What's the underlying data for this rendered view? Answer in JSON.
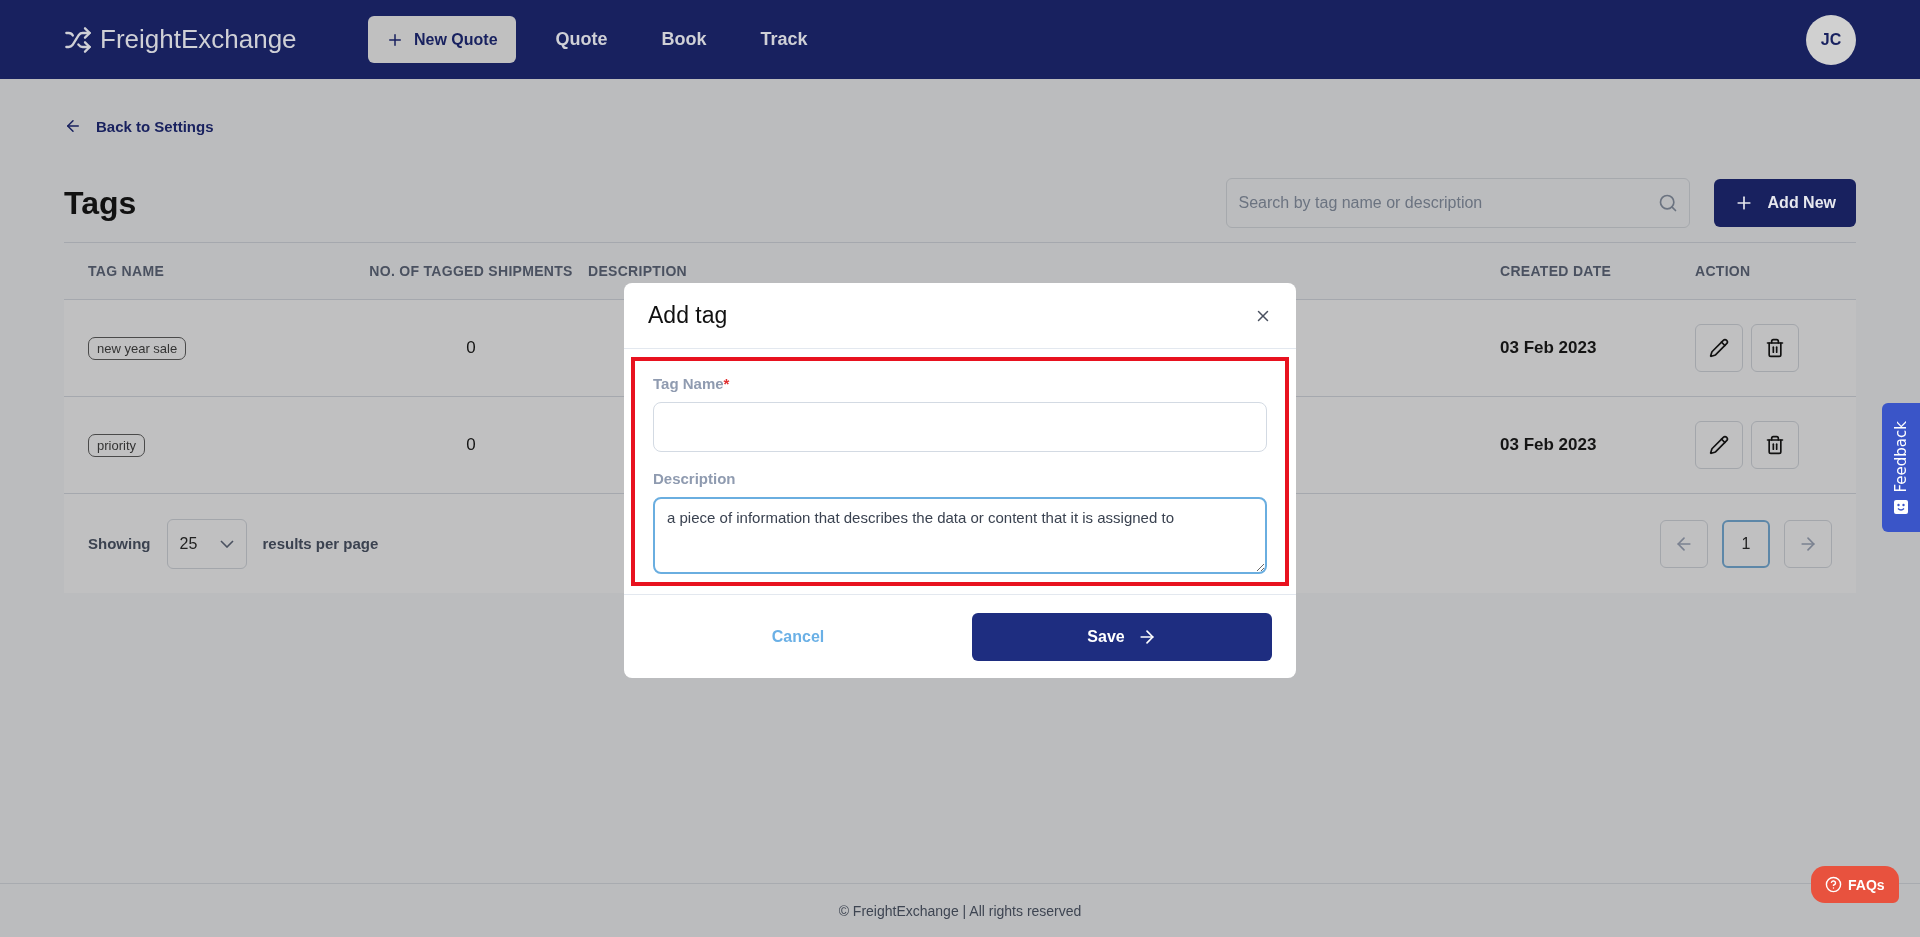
{
  "header": {
    "brand": "FreightExchange",
    "new_quote": "New Quote",
    "nav": [
      {
        "label": "Quote",
        "selected": false
      },
      {
        "label": "Book",
        "selected": false
      },
      {
        "label": "Track",
        "selected": false
      }
    ],
    "avatar": "JC"
  },
  "back_link": "Back to Settings",
  "title": "Tags",
  "search": {
    "placeholder": "Search by tag name or description"
  },
  "add_button": "Add New",
  "table": {
    "columns": [
      "TAG NAME",
      "NO. OF TAGGED SHIPMENTS",
      "DESCRIPTION",
      "CREATED DATE",
      "ACTION"
    ],
    "rows": [
      {
        "tag": "new year sale",
        "count": "0",
        "created": "03 Feb 2023"
      },
      {
        "tag": "priority",
        "count": "0",
        "created": "03 Feb 2023"
      }
    ]
  },
  "pagination": {
    "showing": "Showing",
    "per_page": "25",
    "suffix": "results per page",
    "pages": [
      {
        "label": "1",
        "selected": true
      }
    ]
  },
  "modal": {
    "title": "Add tag",
    "fields": [
      {
        "label": "Tag Name",
        "required_mark": "*",
        "kind": "input",
        "focused": false
      },
      {
        "label": "Description",
        "kind": "textarea",
        "value": "a piece of information that describes the data or content that it is assigned to",
        "focused": true
      }
    ],
    "cancel": "Cancel",
    "save": "Save"
  },
  "feedback": "Feedback",
  "faqs": "FAQs",
  "footer": "© FreightExchange | All rights reserved"
}
